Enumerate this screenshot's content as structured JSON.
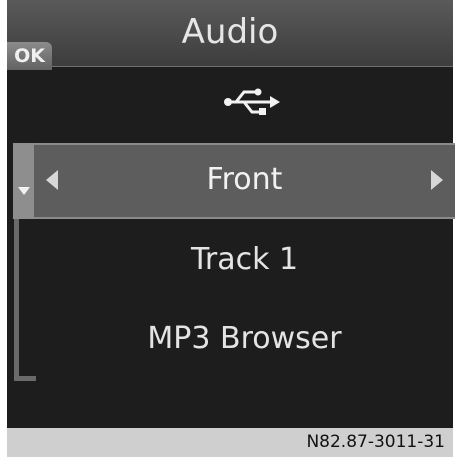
{
  "header": {
    "title": "Audio",
    "ok_label": "OK"
  },
  "source_icon": "usb-icon",
  "menu": {
    "items": [
      {
        "label": "Front",
        "selected": true
      },
      {
        "label": "Track 1",
        "selected": false
      },
      {
        "label": "MP3 Browser",
        "selected": false
      }
    ]
  },
  "footer": {
    "code": "N82.87-3011-31"
  },
  "colors": {
    "screen_bg": "#1d1d1d",
    "header_bg": "#4a4a4a",
    "highlight_bg": "#5d5d5d",
    "text": "#e4e4e4",
    "footer_bg": "#cfcfcf"
  }
}
